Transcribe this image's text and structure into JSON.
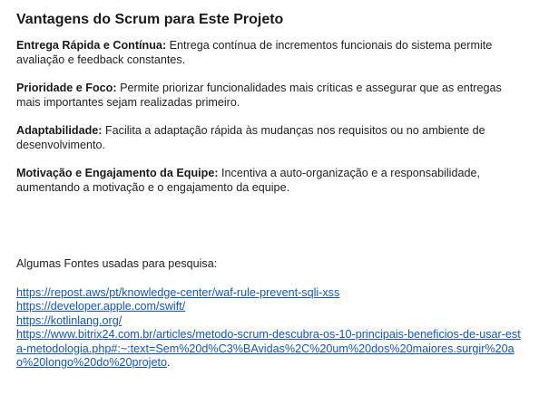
{
  "document": {
    "title": "Vantagens do Scrum para Este Projeto",
    "items": [
      {
        "label": "Entrega Rápida e Contínua:",
        "text": " Entrega contínua de incrementos funcionais do sistema permite avaliação e feedback constantes."
      },
      {
        "label": "Prioridade e Foco:",
        "text": " Permite priorizar funcionalidades mais críticas e assegurar que as entregas mais importantes sejam realizadas primeiro."
      },
      {
        "label": "Adaptabilidade:",
        "text": " Facilita a adaptação rápida às mudanças nos requisitos ou no ambiente de desenvolvimento."
      },
      {
        "label": "Motivação e Engajamento da Equipe:",
        "text": " Incentiva a auto-organização e a responsabilidade, aumentando a motivação e o engajamento da equipe."
      }
    ],
    "sources_heading": "Algumas Fontes usadas para pesquisa:",
    "links": [
      "https://repost.aws/pt/knowledge-center/waf-rule-prevent-sqli-xss",
      "https://developer.apple.com/swift/",
      "https://kotlinlang.org/",
      "https://www.bitrix24.com.br/articles/metodo-scrum-descubra-os-10-principais-beneficios-de-usar-esta-metodologia.php#:~:text=Sem%20d%C3%BAvidas%2C%20um%20dos%20maiores.surgir%20ao%20longo%20do%20projeto"
    ],
    "trailing_punct": "."
  }
}
